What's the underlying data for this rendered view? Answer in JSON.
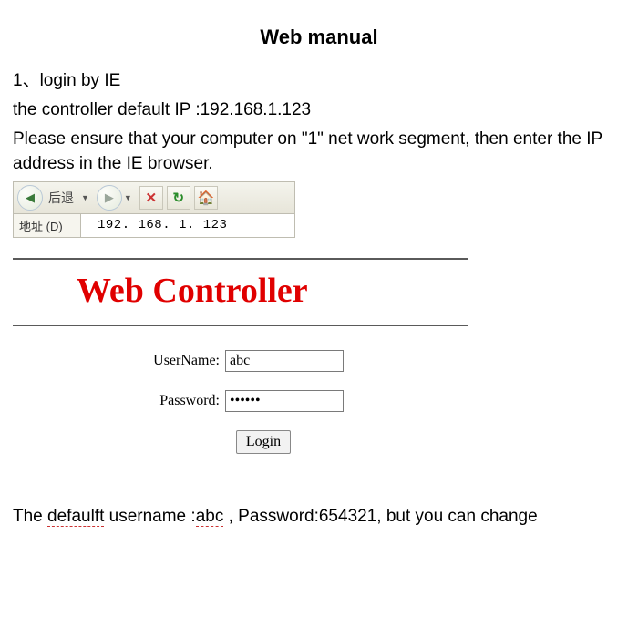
{
  "title": "Web manual",
  "intro": {
    "line1": "1、login by IE",
    "line2": "the controller default IP :192.168.1.123",
    "line3": "Please ensure that your computer on \"1\" net work segment, then enter the IP address in the IE browser."
  },
  "toolbar": {
    "back_label": "后退",
    "address_label": "地址 (D)",
    "address_value": "192. 168. 1. 123"
  },
  "login": {
    "heading": "Web Controller",
    "username_label": "UserName:",
    "username_value": "abc",
    "password_label": "Password:",
    "password_value": "••••••",
    "login_button": "Login"
  },
  "footer": {
    "part1": "The ",
    "defaulft": "defaulft",
    "part2": " username :",
    "abc": "abc",
    "part3": " , Password:654321, but you can change"
  }
}
